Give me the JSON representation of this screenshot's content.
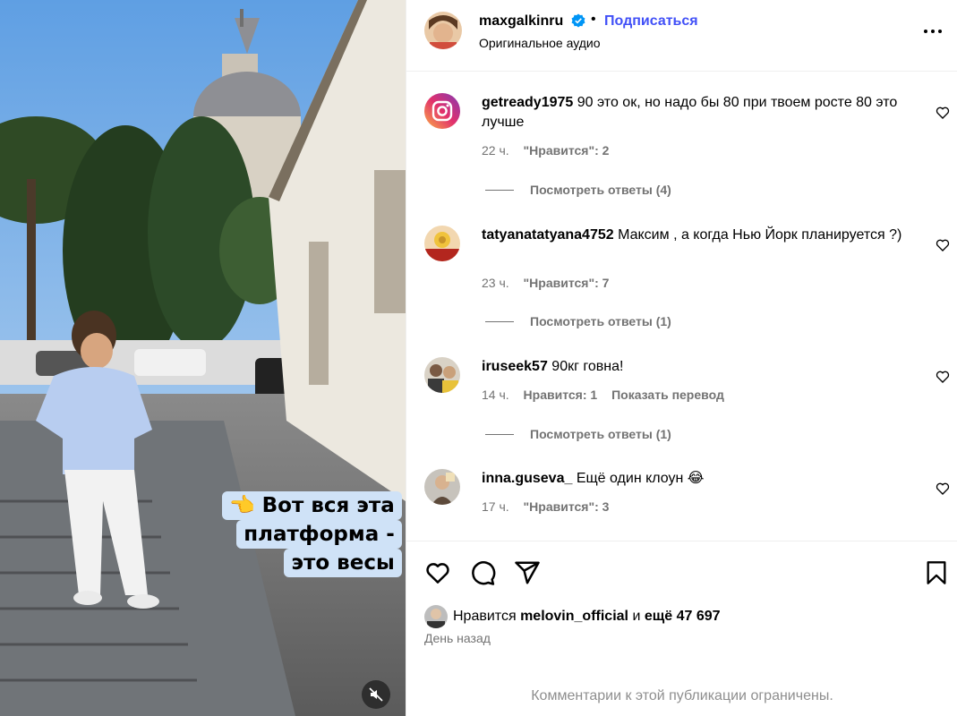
{
  "post": {
    "username": "maxgalkinru",
    "verified": true,
    "separator": "•",
    "follow_label": "Подписаться",
    "audio": "Оригинальное аудио",
    "more_icon": "more-options-icon"
  },
  "media": {
    "caption_lines": [
      "👈 Вот вся эта",
      "платформа -",
      "это весы"
    ],
    "mute_icon": "speaker-muted-icon"
  },
  "comments": [
    {
      "username": "getready1975",
      "text": "90 это ок, но надо бы 80 при твоем росте 80 это лучше",
      "time": "22 ч.",
      "likes": "\"Нравится\": 2",
      "replies": "Посмотреть ответы (4)"
    },
    {
      "username": "tatyanatatyana4752",
      "text": "Максим , а когда Нью Йорк планируется ?)",
      "time": "23 ч.",
      "likes": "\"Нравится\": 7",
      "replies": "Посмотреть ответы (1)"
    },
    {
      "username": "iruseek57",
      "text": "90кг говна!",
      "time": "14 ч.",
      "likes": "Нравится: 1",
      "translate": "Показать перевод",
      "replies": "Посмотреть ответы (1)"
    },
    {
      "username": "inna.guseva_",
      "text": "Ещё один клоун 😂",
      "time": "17 ч.",
      "likes": "\"Нравится\": 3"
    }
  ],
  "actions": {
    "icons": [
      "heart-icon",
      "comment-icon",
      "share-icon",
      "bookmark-icon"
    ],
    "liked_prefix": "Нравится",
    "liked_user": "melovin_official",
    "liked_and": "и",
    "liked_more": "ещё 47 697",
    "date": "День назад",
    "restricted": "Комментарии к этой публикации ограничены."
  }
}
